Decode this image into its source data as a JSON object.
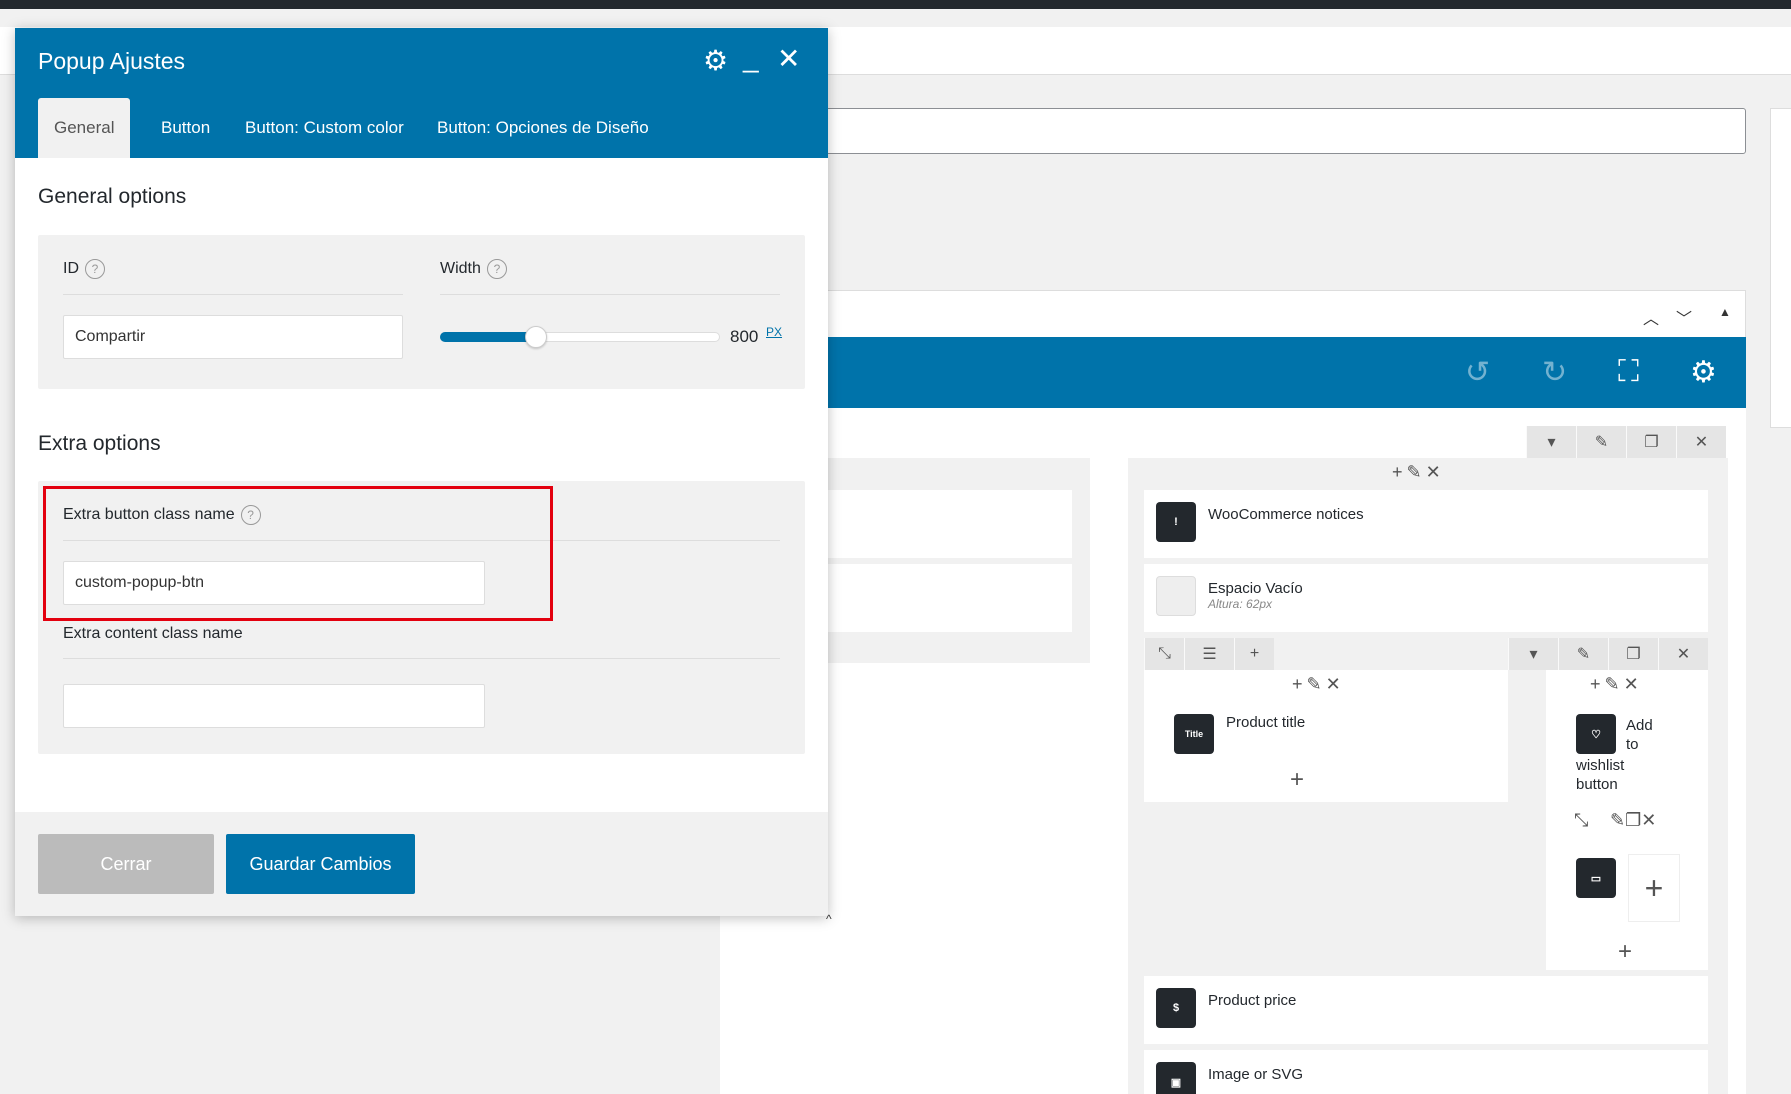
{
  "popup": {
    "title": "Popup Ajustes",
    "tabs": [
      "General",
      "Button",
      "Button: Custom color",
      "Button: Opciones de Diseño"
    ],
    "general_title": "General options",
    "id_label": "ID",
    "id_value": "Compartir",
    "width_label": "Width",
    "width_value": "800",
    "width_unit": "PX",
    "width_fraction": 0.34,
    "extra_title": "Extra options",
    "extra_button_label": "Extra button class name",
    "extra_button_value": "custom-popup-btn",
    "extra_content_label": "Extra content class name",
    "extra_content_value": "",
    "help_symbol": "?",
    "close_label": "Cerrar",
    "save_label": "Guardar Cambios"
  },
  "builder": {
    "elements": {
      "woo_notices": "WooCommerce notices",
      "espacio": "Espacio Vacío",
      "espacio_sub": "Altura: 62px",
      "product_title": "Product title",
      "title_icon_text": "Title",
      "wishlist_l1": "Add",
      "wishlist_l2": "to",
      "wishlist_l3": "wishlist",
      "wishlist_l4": "button",
      "product_price": "Product price",
      "image_svg": "Image or SVG"
    }
  },
  "colors": {
    "accent": "#0073aa",
    "highlight": "#e3000f"
  }
}
